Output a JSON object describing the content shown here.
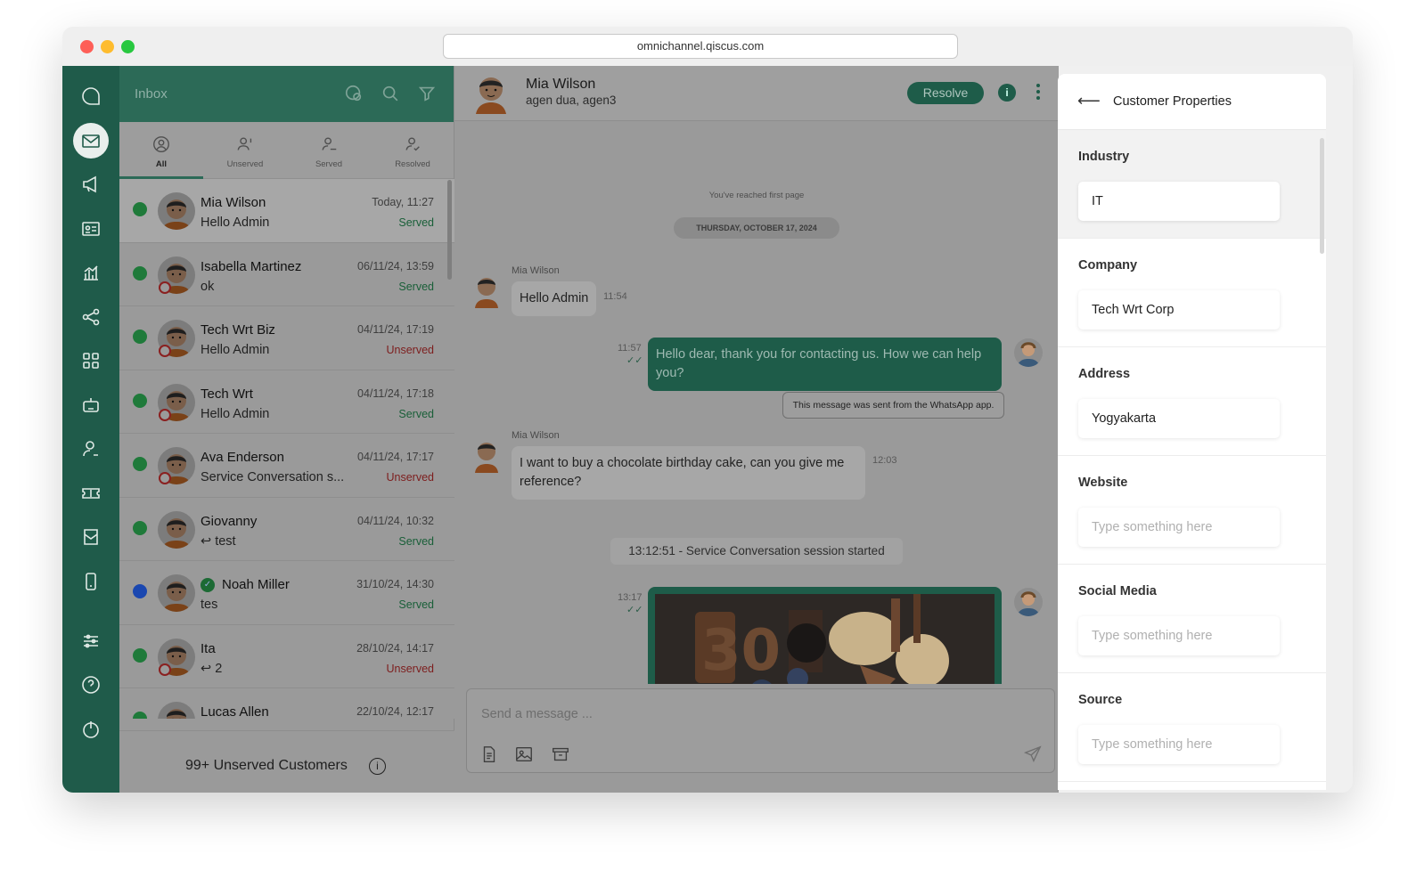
{
  "browser": {
    "url": "omnichannel.qiscus.com"
  },
  "rail": {
    "icons": [
      "logo-icon",
      "inbox-icon",
      "broadcast-icon",
      "contacts-icon",
      "analytics-icon",
      "integration-icon",
      "apps-icon",
      "bot-icon",
      "agent-icon",
      "ticket-icon",
      "mailbox-icon",
      "mobile-icon",
      "settings-icon",
      "help-icon",
      "logout-icon"
    ]
  },
  "inbox": {
    "title": "Inbox",
    "tabs": [
      {
        "label": "All",
        "icon": "user-circle-icon"
      },
      {
        "label": "Unserved",
        "icon": "user-alert-icon"
      },
      {
        "label": "Served",
        "icon": "user-check-icon"
      },
      {
        "label": "Resolved",
        "icon": "user-resolved-icon"
      }
    ],
    "conversations": [
      {
        "name": "Mia Wilson",
        "message": "Hello Admin",
        "time": "Today, 11:27",
        "status": "Served"
      },
      {
        "name": "Isabella Martinez",
        "message": "ok",
        "time": "06/11/24, 13:59",
        "status": "Served"
      },
      {
        "name": "Tech Wrt Biz",
        "message": "Hello Admin",
        "time": "04/11/24, 17:19",
        "status": "Unserved"
      },
      {
        "name": "Tech Wrt",
        "message": "Hello Admin",
        "time": "04/11/24, 17:18",
        "status": "Served"
      },
      {
        "name": "Ava Enderson",
        "message": "Service Conversation s...",
        "time": "04/11/24, 17:17",
        "status": "Unserved"
      },
      {
        "name": "Giovanny",
        "message": "test",
        "time": "04/11/24, 10:32",
        "status": "Served"
      },
      {
        "name": "Noah Miller",
        "message": "tes",
        "time": "31/10/24, 14:30",
        "status": "Served"
      },
      {
        "name": "Ita",
        "message": "2",
        "time": "28/10/24, 14:17",
        "status": "Unserved"
      },
      {
        "name": "Lucas Allen",
        "message": "",
        "time": "22/10/24, 12:17",
        "status": ""
      }
    ],
    "footer": "99+ Unserved Customers"
  },
  "chat": {
    "name": "Mia Wilson",
    "agents": "agen dua, agen3",
    "resolve_label": "Resolve",
    "info_label": "i",
    "first_page": "You've reached first page",
    "date": "THURSDAY, OCTOBER 17, 2024",
    "messages": [
      {
        "sender": "Mia Wilson",
        "text": "Hello Admin",
        "time": "11:54"
      },
      {
        "text": "Hello dear, thank you for contacting us. How we can help you?",
        "time": "11:57"
      },
      {
        "sender": "Mia Wilson",
        "text": "I want to buy a chocolate birthday cake, can you give me reference?",
        "time": "12:03"
      },
      {
        "time": "13:17"
      }
    ],
    "wa_note": "This message was sent from the WhatsApp app.",
    "session_note": "13:12:51 - Service Conversation session started",
    "composer_placeholder": "Send a message ..."
  },
  "properties": {
    "title": "Customer Properties",
    "fields": [
      {
        "label": "Industry",
        "value": "IT",
        "placeholder": ""
      },
      {
        "label": "Company",
        "value": "Tech Wrt Corp",
        "placeholder": ""
      },
      {
        "label": "Address",
        "value": "Yogyakarta",
        "placeholder": ""
      },
      {
        "label": "Website",
        "value": "",
        "placeholder": "Type something here"
      },
      {
        "label": "Social Media",
        "value": "",
        "placeholder": "Type something here"
      },
      {
        "label": "Source",
        "value": "",
        "placeholder": "Type something here"
      }
    ]
  },
  "colors": {
    "brand": "#1f5b4a",
    "served": "#195f38",
    "unserved": "#7d1d1d"
  }
}
